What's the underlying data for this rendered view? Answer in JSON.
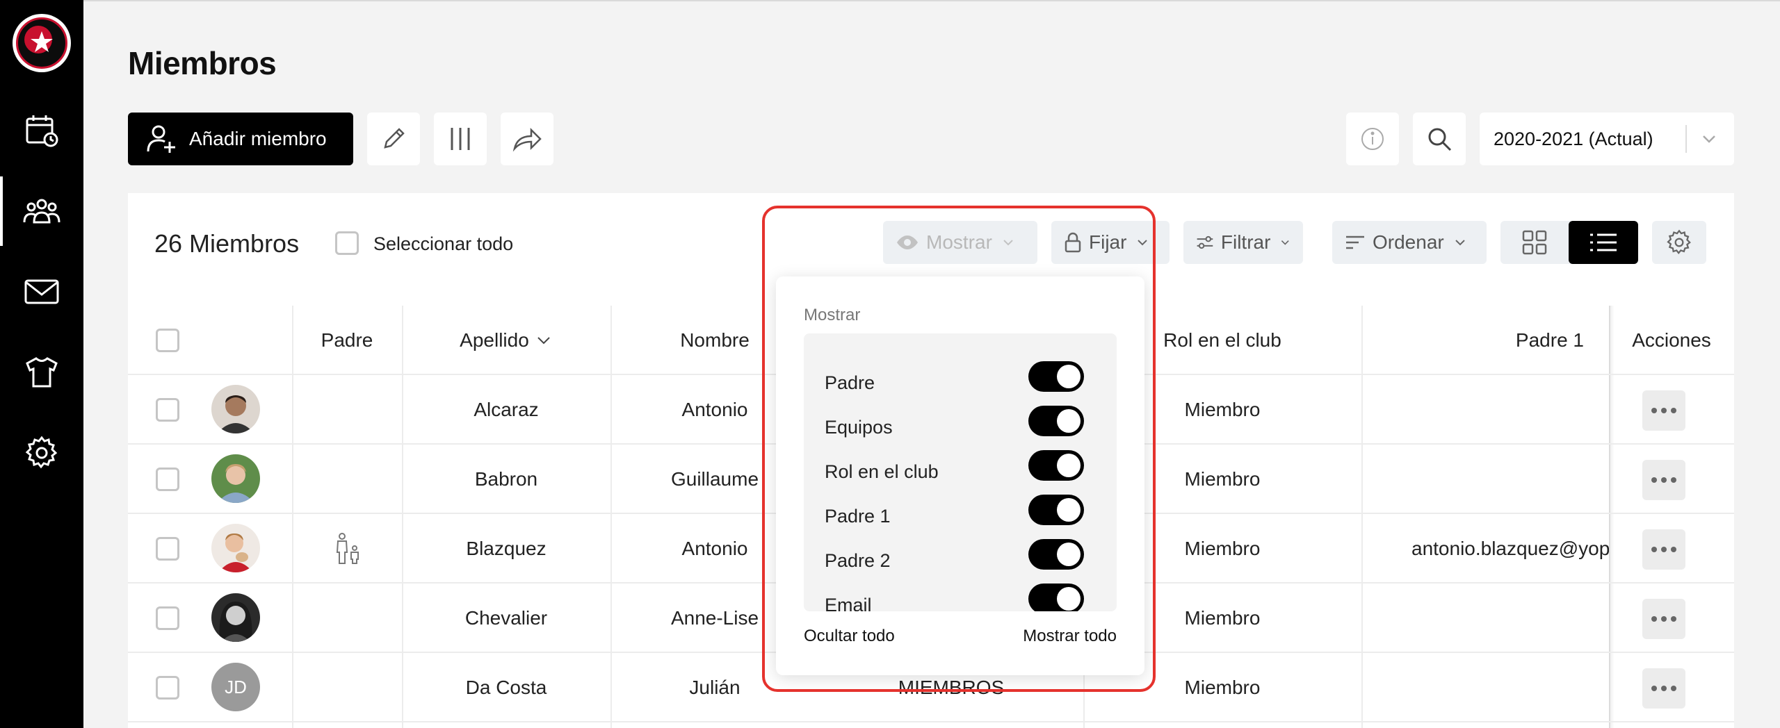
{
  "page": {
    "title": "Miembros"
  },
  "toolbar": {
    "add_member_label": "Añadir miembro",
    "season_label": "2020-2021 (Actual)"
  },
  "card": {
    "members_count": "26 Miembros",
    "select_all_label": "Seleccionar todo",
    "chips": {
      "mostrar": "Mostrar",
      "fijar": "Fijar",
      "filtrar": "Filtrar",
      "ordenar": "Ordenar"
    }
  },
  "table": {
    "headers": {
      "padre": "Padre",
      "apellido": "Apellido",
      "nombre": "Nombre",
      "rol": "Rol en el club",
      "padre1": "Padre 1",
      "acciones": "Acciones"
    },
    "rows": [
      {
        "apellido": "Alcaraz",
        "nombre": "Antonio",
        "rol": "Miembro",
        "padre1": ""
      },
      {
        "apellido": "Babron",
        "nombre": "Guillaume",
        "rol": "Miembro",
        "padre1": ""
      },
      {
        "apellido": "Blazquez",
        "nombre": "Antonio",
        "rol": "Miembro",
        "padre1": "antonio.blazquez@yop"
      },
      {
        "apellido": "Chevalier",
        "nombre": "Anne-Lise",
        "rol": "Miembro",
        "padre1": ""
      },
      {
        "apellido": "Da Costa",
        "nombre": "Julián",
        "rol": "Miembro",
        "padre1": "",
        "initials": "JD",
        "team": "MIEMBROS"
      }
    ]
  },
  "popup": {
    "title": "Mostrar",
    "items": [
      "Padre",
      "Equipos",
      "Rol en el club",
      "Padre 1",
      "Padre 2",
      "Email"
    ],
    "hide_all": "Ocultar todo",
    "show_all": "Mostrar todo"
  },
  "colors": {
    "highlight": "#e5322d",
    "brand_red": "#c8102e",
    "primary": "#000000"
  }
}
